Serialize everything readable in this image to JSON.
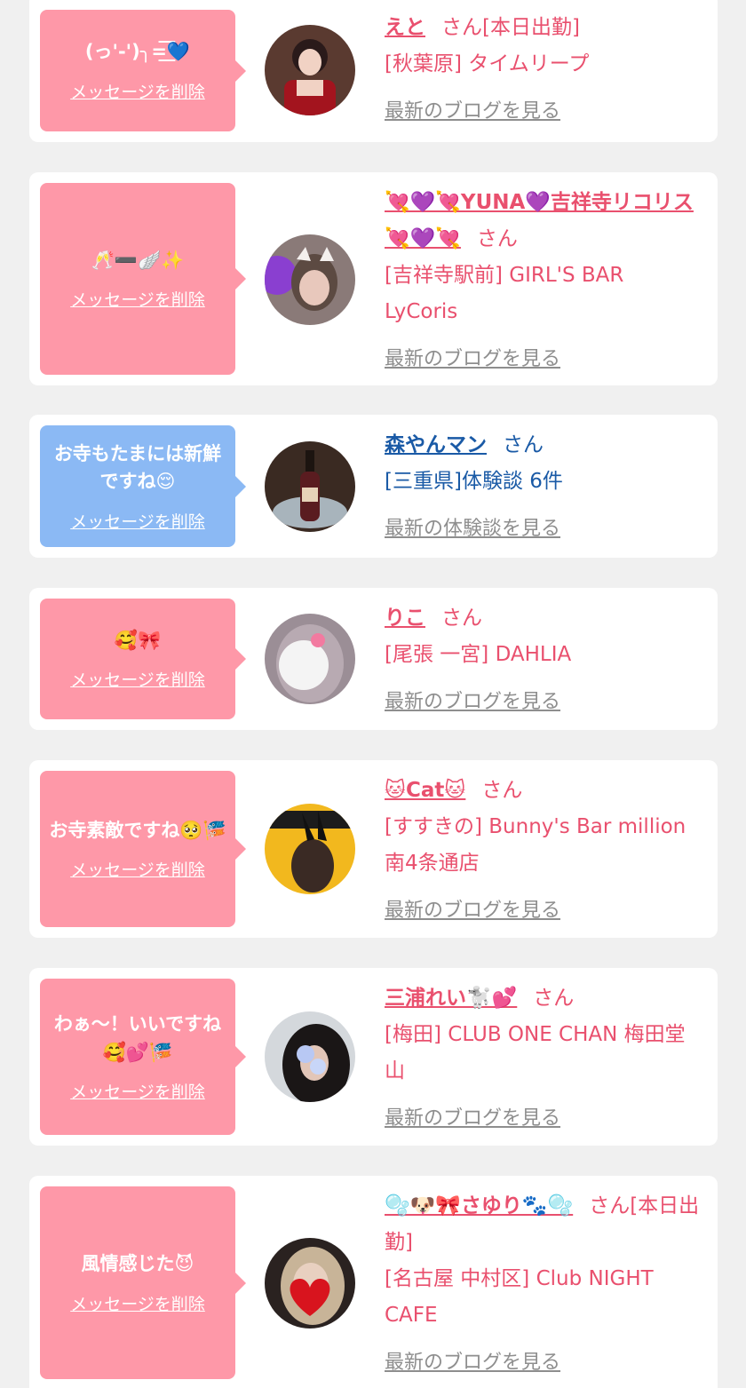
{
  "items": [
    {
      "message": "(っ'-')╮=͟͟͞💙",
      "delete_label": "メッセージを削除",
      "name": "えと",
      "honorific": "さん[本日出勤]",
      "shop": "[秋葉原] タイムリープ",
      "more_label": "最新のブログを見る",
      "theme": "pink"
    },
    {
      "message": "🥂➖🪽✨",
      "delete_label": "メッセージを削除",
      "name": "💘💜💘YUNA💜吉祥寺リコリス💘💜💘",
      "honorific": "さん",
      "shop": "[吉祥寺駅前] GIRL'S BAR LyCoris",
      "more_label": "最新のブログを見る",
      "theme": "pink"
    },
    {
      "message": "お寺もたまには新鮮ですね😌",
      "delete_label": "メッセージを削除",
      "name": "森やんマン",
      "honorific": "さん",
      "shop": "[三重県]体験談 6件",
      "more_label": "最新の体験談を見る",
      "theme": "blue"
    },
    {
      "message": "🥰🎀",
      "delete_label": "メッセージを削除",
      "name": "りこ",
      "honorific": "さん",
      "shop": "[尾張 一宮] DAHLIA",
      "more_label": "最新のブログを見る",
      "theme": "pink"
    },
    {
      "message": "お寺素敵ですね🥺🎏",
      "delete_label": "メッセージを削除",
      "name": "🐱Cat🐱",
      "honorific": "さん",
      "shop": "[すすきの] Bunny's Bar million 南4条通店",
      "more_label": "最新のブログを見る",
      "theme": "pink"
    },
    {
      "message": "わぁ〜！いいですね🥰💕🎏",
      "delete_label": "メッセージを削除",
      "name": "三浦れい🐩💕",
      "honorific": "さん",
      "shop": "[梅田] CLUB ONE CHAN 梅田堂山",
      "more_label": "最新のブログを見る",
      "theme": "pink"
    },
    {
      "message": "風情感じた😈",
      "delete_label": "メッセージを削除",
      "name": "🫧🐶🎀さゆり🐾🫧",
      "honorific": "さん[本日出勤]",
      "shop": "[名古屋 中村区] Club NIGHT CAFE",
      "more_label": "最新のブログを見る",
      "theme": "pink"
    }
  ],
  "colors": {
    "pink_bubble": "#fe98a8",
    "blue_bubble": "#8bb9f4",
    "pink_text": "#e9506e",
    "blue_text": "#1a5aa6",
    "link_gray": "#8e8e8e",
    "background": "#f0f0f0"
  }
}
